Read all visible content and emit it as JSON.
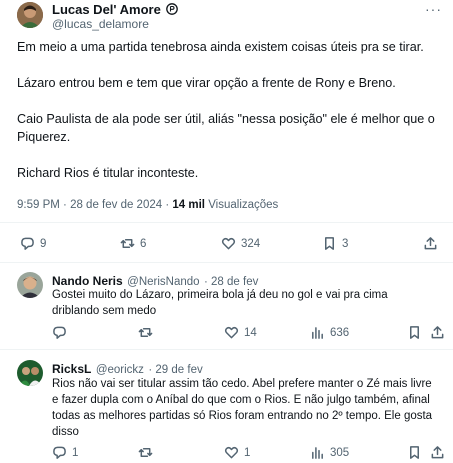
{
  "tweet": {
    "author_name": "Lucas Del' Amore",
    "author_handle": "@lucas_delamore",
    "paragraphs": [
      "Em meio a uma partida tenebrosa ainda existem coisas úteis pra se tirar.",
      "Lázaro entrou bem e tem que virar opção a frente de Rony e Breno.",
      "Caio Paulista de ala pode ser útil, aliás \"nessa posição\" ele é melhor que o Piquerez.",
      "Richard Rios é titular inconteste."
    ],
    "time": "9:59 PM",
    "date": "28 de fev de 2024",
    "views_count": "14 mil",
    "views_label": "Visualizações",
    "replies": "9",
    "retweets": "6",
    "likes": "324",
    "bookmarks": "3"
  },
  "replies": [
    {
      "name": "Nando Neris",
      "handle": "@NerisNando",
      "date": "28 de fev",
      "text": "Gostei muito do Lázaro, primeira bola já deu no gol e vai pra cima driblando sem medo",
      "replies": "",
      "retweets": "",
      "likes": "14",
      "views": "636"
    },
    {
      "name": "RicksL",
      "handle": "@eorickz",
      "date": "29 de fev",
      "text": "Rios não vai ser titular assim tão cedo. Abel prefere manter o Zé mais livre e fazer dupla com o Aníbal do que com o Rios. E não julgo também, afinal todas as melhores partidas só Rios foram entrando no 2º tempo. Ele gosta disso",
      "replies": "1",
      "retweets": "",
      "likes": "1",
      "views": "305"
    }
  ],
  "colors": {
    "text": "#0f1419",
    "muted": "#536471",
    "divider": "#eff3f4"
  }
}
